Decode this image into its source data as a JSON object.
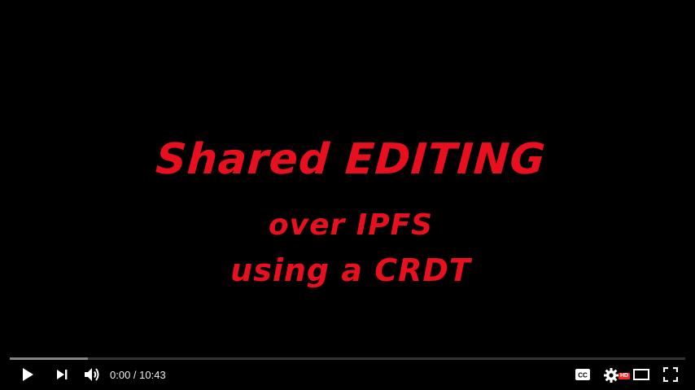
{
  "video": {
    "title_line1": "Shared EDITING",
    "title_line2": "over IPFS",
    "title_line3": "using a CRDT",
    "title_color": "#e8101e"
  },
  "progress": {
    "played_fraction": 0.0,
    "loaded_fraction": 0.116
  },
  "controls": {
    "current_time": "0:00",
    "separator": " / ",
    "duration": "10:43",
    "quality_badge": "HD",
    "icons": {
      "play": "play-icon",
      "next": "next-icon",
      "volume": "volume-icon",
      "subtitles": "closed-captions-icon",
      "settings": "gear-icon",
      "theater": "theater-mode-icon",
      "fullscreen": "fullscreen-icon"
    }
  }
}
